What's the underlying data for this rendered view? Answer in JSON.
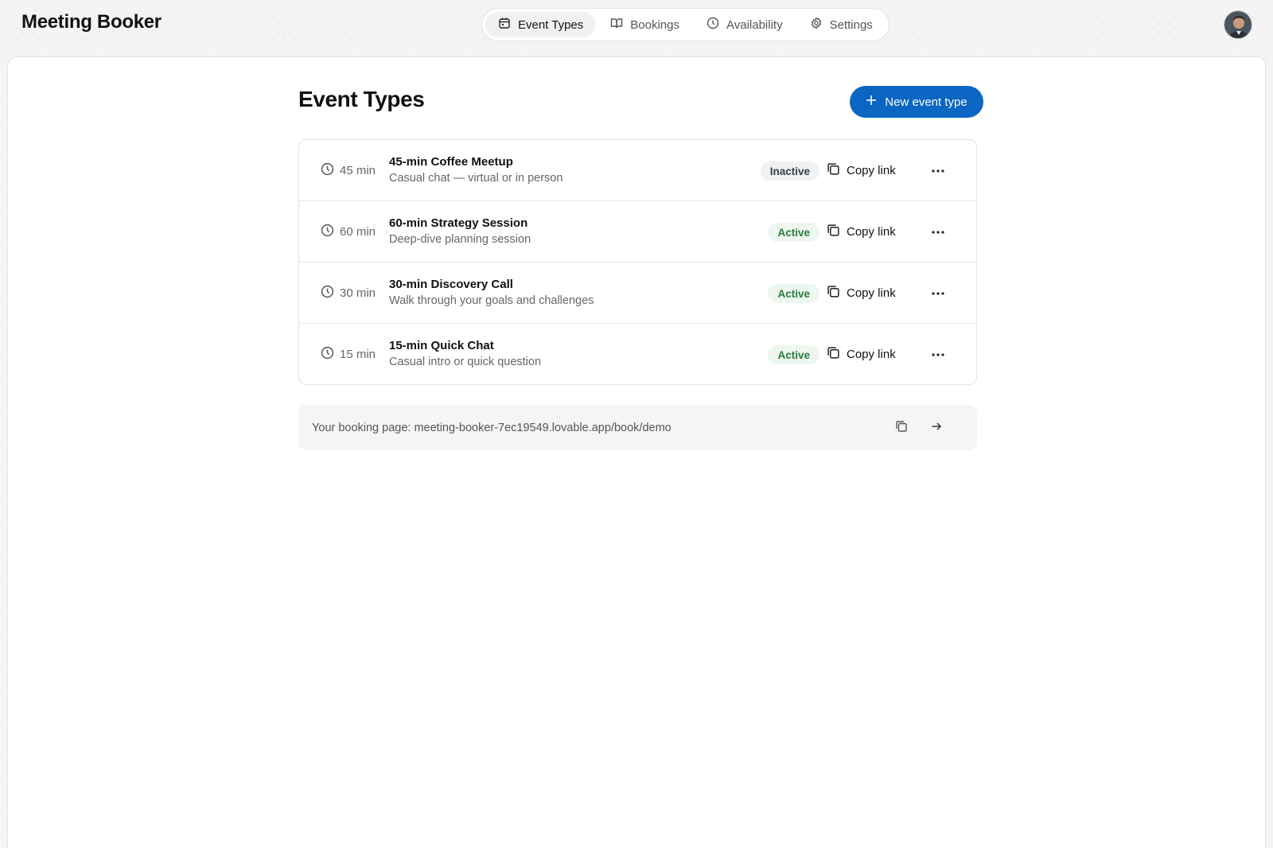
{
  "app": {
    "title": "Meeting Booker"
  },
  "nav": [
    {
      "label": "Event Types",
      "icon": "calendar-icon",
      "active": true
    },
    {
      "label": "Bookings",
      "icon": "book-icon",
      "active": false
    },
    {
      "label": "Availability",
      "icon": "clock-icon",
      "active": false
    },
    {
      "label": "Settings",
      "icon": "gear-icon",
      "active": false
    }
  ],
  "page": {
    "title": "Event Types",
    "new_button_label": "New event type"
  },
  "events": [
    {
      "duration": "45 min",
      "title": "45-min Coffee Meetup",
      "description": "Casual chat — virtual or in person",
      "status": "Inactive",
      "copy_label": "Copy link"
    },
    {
      "duration": "60 min",
      "title": "60-min Strategy Session",
      "description": "Deep-dive planning session",
      "status": "Active",
      "copy_label": "Copy link"
    },
    {
      "duration": "30 min",
      "title": "30-min Discovery Call",
      "description": "Walk through your goals and challenges",
      "status": "Active",
      "copy_label": "Copy link"
    },
    {
      "duration": "15 min",
      "title": "15-min Quick Chat",
      "description": "Casual intro or quick question",
      "status": "Active",
      "copy_label": "Copy link"
    }
  ],
  "booking_page": {
    "text": "Your booking page: meeting-booker-7ec19549.lovable.app/book/demo"
  },
  "colors": {
    "accent": "#0a66c2",
    "active_text": "#2a7a3c",
    "active_bg": "#edf7ef",
    "inactive_bg": "#f0f1f3"
  }
}
